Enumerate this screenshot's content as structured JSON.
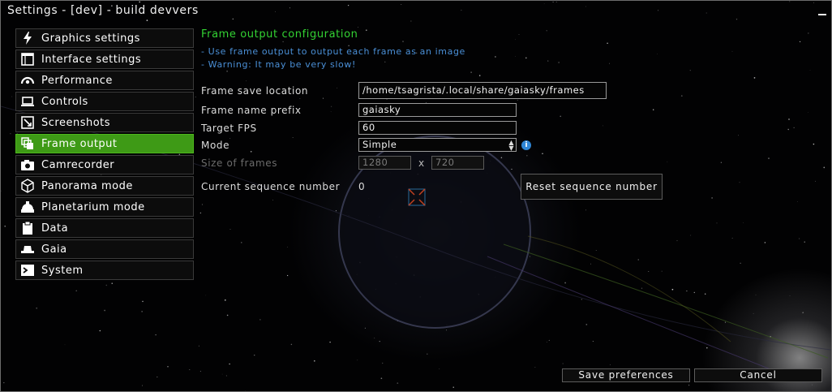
{
  "window": {
    "title": "Settings - [dev] - build devvers"
  },
  "sidebar": {
    "items": [
      {
        "label": "Graphics settings",
        "icon": "lightning-icon"
      },
      {
        "label": "Interface settings",
        "icon": "window-icon"
      },
      {
        "label": "Performance",
        "icon": "gauge-icon"
      },
      {
        "label": "Controls",
        "icon": "laptop-icon"
      },
      {
        "label": "Screenshots",
        "icon": "screenshot-icon"
      },
      {
        "label": "Frame output",
        "icon": "frames-icon",
        "active": true
      },
      {
        "label": "Camrecorder",
        "icon": "camera-icon"
      },
      {
        "label": "Panorama mode",
        "icon": "cube-icon"
      },
      {
        "label": "Planetarium mode",
        "icon": "planetarium-icon"
      },
      {
        "label": "Data",
        "icon": "clipboard-icon"
      },
      {
        "label": "Gaia",
        "icon": "gaia-icon"
      },
      {
        "label": "System",
        "icon": "terminal-icon"
      }
    ]
  },
  "main": {
    "title": "Frame output configuration",
    "info_lines": [
      "- Use frame output to output each frame as an image",
      "- Warning: It may be very slow!"
    ],
    "save_location": {
      "label": "Frame save location",
      "value": "/home/tsagrista/.local/share/gaiasky/frames"
    },
    "name_prefix": {
      "label": "Frame name prefix",
      "value": "gaiasky"
    },
    "target_fps": {
      "label": "Target FPS",
      "value": "60"
    },
    "mode": {
      "label": "Mode",
      "value": "Simple"
    },
    "size": {
      "label": "Size of frames",
      "width": "1280",
      "separator": "x",
      "height": "720"
    },
    "sequence": {
      "label": "Current sequence number",
      "value": "0",
      "reset_label": "Reset sequence number"
    }
  },
  "footer": {
    "save_label": "Save preferences",
    "cancel_label": "Cancel"
  },
  "colors": {
    "accent": "#3e9a16",
    "title_green": "#33d333",
    "info_blue": "#4a8fd6"
  }
}
